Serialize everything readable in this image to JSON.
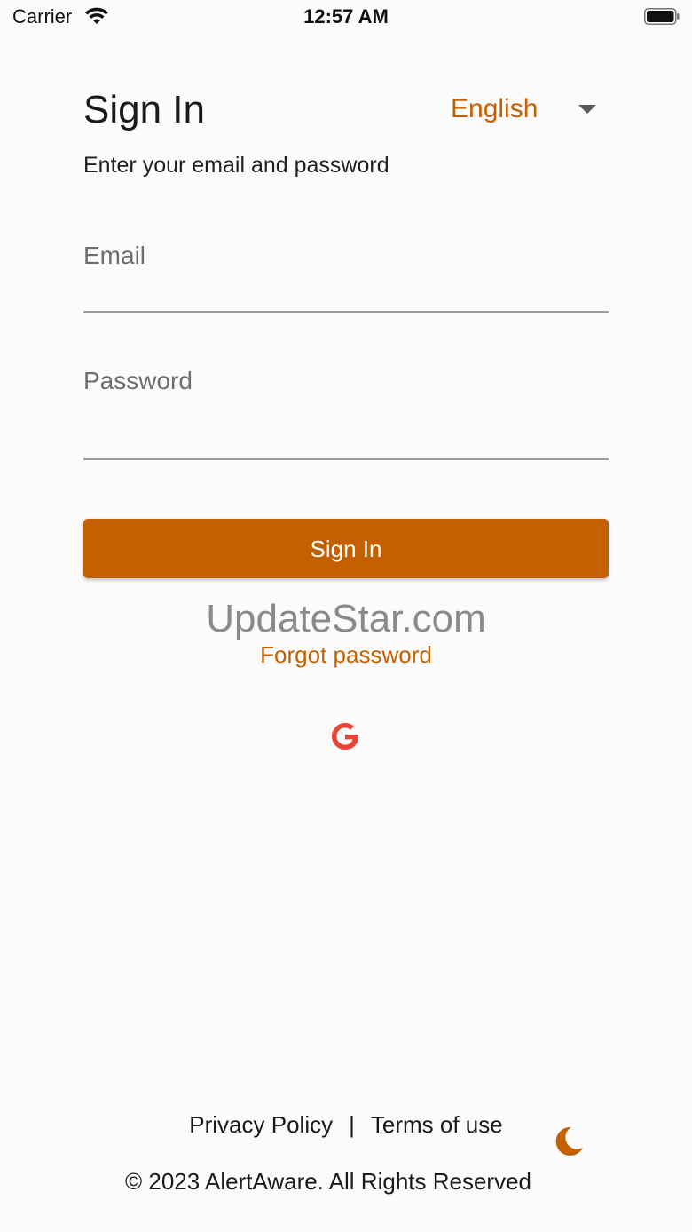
{
  "status_bar": {
    "carrier": "Carrier",
    "time": "12:57 AM"
  },
  "header": {
    "title": "Sign In",
    "language": "English",
    "subtitle": "Enter your email and password"
  },
  "form": {
    "email_placeholder": "Email",
    "password_placeholder": "Password",
    "signin_label": "Sign In",
    "forgot_label": "Forgot password"
  },
  "watermark": "UpdateStar.com",
  "footer": {
    "privacy": "Privacy Policy",
    "separator": "|",
    "terms": "Terms of use",
    "copyright": "© 2023 AlertAware. All Rights Reserved"
  },
  "colors": {
    "accent": "#c46000",
    "google_red": "#ea4335"
  },
  "icons": {
    "wifi": "wifi-icon",
    "battery": "battery-icon",
    "caret": "caret-down-icon",
    "google": "google-icon",
    "theme": "moon-icon"
  }
}
